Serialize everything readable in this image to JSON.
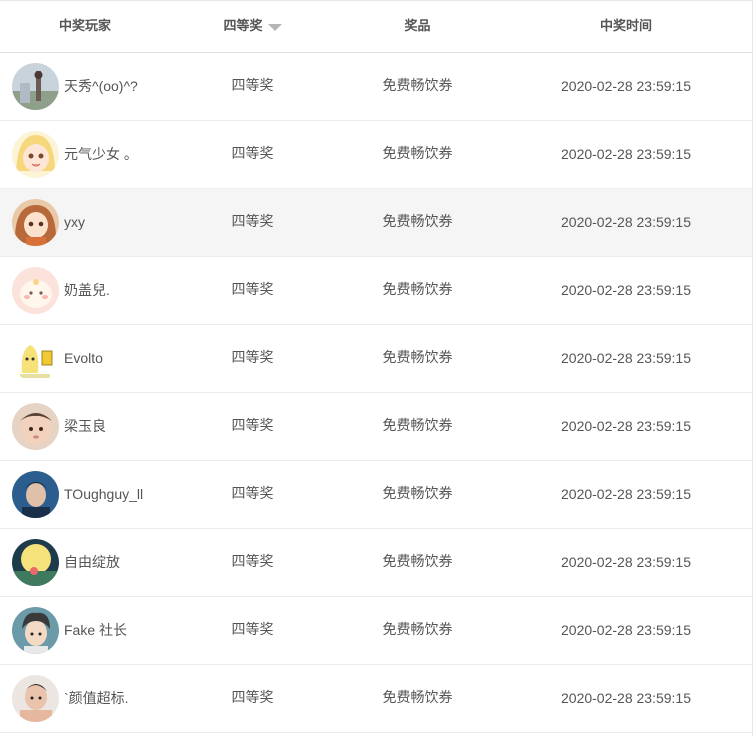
{
  "table": {
    "headers": {
      "player": "中奖玩家",
      "level": "四等奖",
      "prize": "奖品",
      "time": "中奖时间"
    },
    "sort_icon": "caret-down-icon",
    "rows": [
      {
        "name": "天秀^(oo)^?",
        "level": "四等奖",
        "prize": "免费畅饮券",
        "time": "2020-02-28 23:59:15",
        "avatar": "avatar-photo-person-outdoor"
      },
      {
        "name": "元气少女 。",
        "level": "四等奖",
        "prize": "免费畅饮券",
        "time": "2020-02-28 23:59:15",
        "avatar": "avatar-anime-blonde-girl"
      },
      {
        "name": "yxy",
        "level": "四等奖",
        "prize": "免费畅饮券",
        "time": "2020-02-28 23:59:15",
        "avatar": "avatar-anime-orange-girl"
      },
      {
        "name": "奶盖兒.",
        "level": "四等奖",
        "prize": "免费畅饮券",
        "time": "2020-02-28 23:59:15",
        "avatar": "avatar-cartoon-pink"
      },
      {
        "name": "Evolto",
        "level": "四等奖",
        "prize": "免费畅饮券",
        "time": "2020-02-28 23:59:15",
        "avatar": "avatar-cartoon-banana"
      },
      {
        "name": "梁玉良",
        "level": "四等奖",
        "prize": "免费畅饮券",
        "time": "2020-02-28 23:59:15",
        "avatar": "avatar-photo-baby"
      },
      {
        "name": "TOughguy_ll",
        "level": "四等奖",
        "prize": "免费畅饮券",
        "time": "2020-02-28 23:59:15",
        "avatar": "avatar-photo-man-blue"
      },
      {
        "name": "自由绽放",
        "level": "四等奖",
        "prize": "免费畅饮券",
        "time": "2020-02-28 23:59:15",
        "avatar": "avatar-illustration-moon"
      },
      {
        "name": "Fake 社长",
        "level": "四等奖",
        "prize": "免费畅饮券",
        "time": "2020-02-28 23:59:15",
        "avatar": "avatar-anime-boy"
      },
      {
        "name": "`颜值超标.",
        "level": "四等奖",
        "prize": "免费畅饮券",
        "time": "2020-02-28 23:59:15",
        "avatar": "avatar-photo-man-shirtless"
      }
    ]
  },
  "colors": {
    "highlight_row": "#f5f5f5",
    "border": "#ececec",
    "text": "#555555",
    "sort_caret": "#b5b5b5"
  }
}
